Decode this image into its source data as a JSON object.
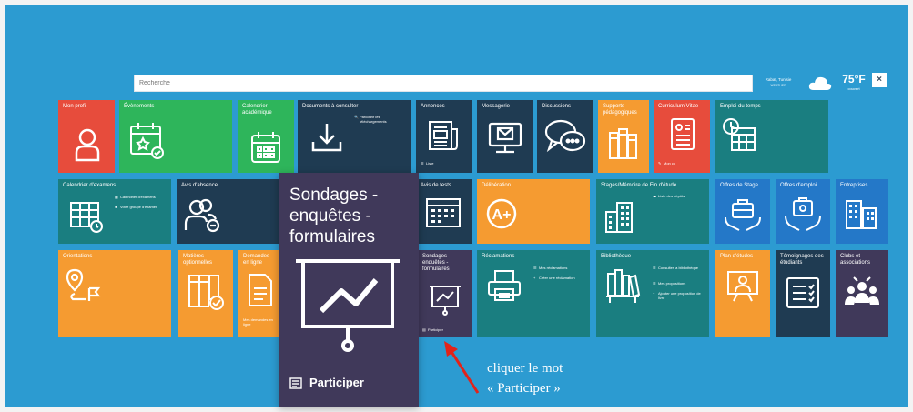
{
  "search": {
    "placeholder": "Recherche"
  },
  "weather": {
    "location": "Rabat, Tunisie",
    "label": "WEATHER",
    "temp": "75°F",
    "condition": "couvert",
    "close": "×"
  },
  "tiles": {
    "profil": {
      "title": "Mon profil"
    },
    "evenements": {
      "title": "Évènements"
    },
    "calendrier_academique": {
      "title": "Calendrier académique"
    },
    "documents": {
      "title": "Documents à consulter",
      "link": "Parcourir les téléchargements"
    },
    "annonces": {
      "title": "Annonces",
      "link": "Liste"
    },
    "messagerie": {
      "title": "Messagerie"
    },
    "discussions": {
      "title": "Discussions"
    },
    "supports": {
      "title": "Supports pédagogiques"
    },
    "cv": {
      "title": "Curriculum Vitae",
      "link": "Mon cv"
    },
    "emploi_temps": {
      "title": "Emploi du temps"
    },
    "calendrier_examens": {
      "title": "Calendrier d'examens",
      "link1": "Calendrier d'examens",
      "link2": "Votre groupe d'examen"
    },
    "absence": {
      "title": "Avis d'absence"
    },
    "avis_tests": {
      "title": "Avis de tests"
    },
    "deliberation": {
      "title": "Délibération"
    },
    "stages": {
      "title": "Stages/Mémoire de Fin d'étude",
      "link": "Liste des dépôts"
    },
    "offres_stage": {
      "title": "Offres de Stage"
    },
    "offres_emploi": {
      "title": "Offres d'emploi"
    },
    "entreprises": {
      "title": "Entreprises"
    },
    "orientations": {
      "title": "Orientations"
    },
    "matieres": {
      "title": "Matières optionnelles"
    },
    "demandes": {
      "title": "Demandes en ligne",
      "link": "Mes demandes en ligne"
    },
    "sondages": {
      "title": "Sondages - enquêtes - formulaires",
      "link": "Participer"
    },
    "reclamations": {
      "title": "Réclamations",
      "link1": "Mes réclamations",
      "link2": "Créer une réclamation"
    },
    "bibliotheque": {
      "title": "Bibliothèque",
      "link1": "Consulter la bibliothèque",
      "link2": "Mes propositions",
      "link3": "Ajouter une proposition de livre"
    },
    "plan_etudes": {
      "title": "Plan d'études"
    },
    "temoignages": {
      "title": "Témoignages des étudiants"
    },
    "clubs": {
      "title": "Clubs et associations"
    }
  },
  "popup": {
    "title": "Sondages - enquêtes - formulaires",
    "button": "Participer"
  },
  "annotation": {
    "line1": "cliquer  le mot",
    "line2": "« Participer »"
  },
  "colors": {
    "background": "#2c9bd1",
    "green": "#2eb55b",
    "red": "#e74c3c",
    "navy": "#1f3b52",
    "teal": "#1a7e80",
    "orange": "#f59b31",
    "blue": "#2478c8",
    "purple": "#40395a",
    "arrow": "#e2231a"
  }
}
